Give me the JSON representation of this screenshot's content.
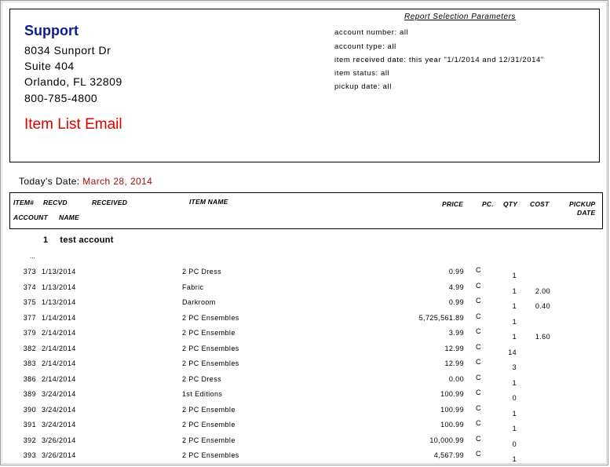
{
  "company": {
    "name": "Support",
    "address_line1": "8034 Sunport Dr",
    "address_line2": "Suite 404",
    "city_state_zip": "Orlando, FL 32809",
    "phone": "800-785-4800"
  },
  "report_title": "Item List Email",
  "params": {
    "title": "Report Selection Parameters",
    "lines": [
      "account number: all",
      "account type: all",
      "item received date: this year \"1/1/2014 and 12/31/2014\"",
      "item status: all",
      "pickup date: all"
    ]
  },
  "today": {
    "label": "Today's Date:",
    "value": "March 28, 2014"
  },
  "columns": {
    "item": "ITEM#",
    "recvd": "RECVD",
    "received": "RECEIVED",
    "item_name": "ITEM NAME",
    "price": "PRICE",
    "pc": "PC.",
    "qty": "QTY",
    "cost": "COST",
    "pickup": "PICKUP",
    "date": "DATE",
    "account": "ACCOUNT",
    "name": "NAME"
  },
  "group": {
    "number": "1",
    "name": "test account",
    "ellipsis": "..."
  },
  "rows": [
    {
      "item": "373",
      "date": "1/13/2014",
      "name": "2 PC Dress",
      "price": "0.99",
      "pc": "C",
      "qty": "1",
      "cost": ""
    },
    {
      "item": "374",
      "date": "1/13/2014",
      "name": "Fabric",
      "price": "4.99",
      "pc": "C",
      "qty": "1",
      "cost": "2.00"
    },
    {
      "item": "375",
      "date": "1/13/2014",
      "name": "Darkroom",
      "price": "0.99",
      "pc": "C",
      "qty": "1",
      "cost": "0.40"
    },
    {
      "item": "377",
      "date": "1/14/2014",
      "name": "2 PC Ensembles",
      "price": "5,725,561.89",
      "pc": "C",
      "qty": "1",
      "cost": ""
    },
    {
      "item": "379",
      "date": "2/14/2014",
      "name": "2 PC Ensemble",
      "price": "3.99",
      "pc": "C",
      "qty": "1",
      "cost": "1.60"
    },
    {
      "item": "382",
      "date": "2/14/2014",
      "name": "2 PC Ensembles",
      "price": "12.99",
      "pc": "C",
      "qty": "14",
      "cost": ""
    },
    {
      "item": "383",
      "date": "2/14/2014",
      "name": "2 PC Ensembles",
      "price": "12.99",
      "pc": "C",
      "qty": "3",
      "cost": ""
    },
    {
      "item": "386",
      "date": "2/14/2014",
      "name": "2 PC Dress",
      "price": "0.00",
      "pc": "C",
      "qty": "1",
      "cost": ""
    },
    {
      "item": "389",
      "date": "3/24/2014",
      "name": "1st Editions",
      "price": "100.99",
      "pc": "C",
      "qty": "0",
      "cost": ""
    },
    {
      "item": "390",
      "date": "3/24/2014",
      "name": "2 PC Ensemble",
      "price": "100.99",
      "pc": "C",
      "qty": "1",
      "cost": ""
    },
    {
      "item": "391",
      "date": "3/24/2014",
      "name": "2 PC Ensemble",
      "price": "100.99",
      "pc": "C",
      "qty": "1",
      "cost": ""
    },
    {
      "item": "392",
      "date": "3/26/2014",
      "name": "2 PC Ensemble",
      "price": "10,000.99",
      "pc": "C",
      "qty": "0",
      "cost": ""
    },
    {
      "item": "393",
      "date": "3/26/2014",
      "name": "2 PC Ensembles",
      "price": "4,567.99",
      "pc": "C",
      "qty": "1",
      "cost": ""
    }
  ]
}
